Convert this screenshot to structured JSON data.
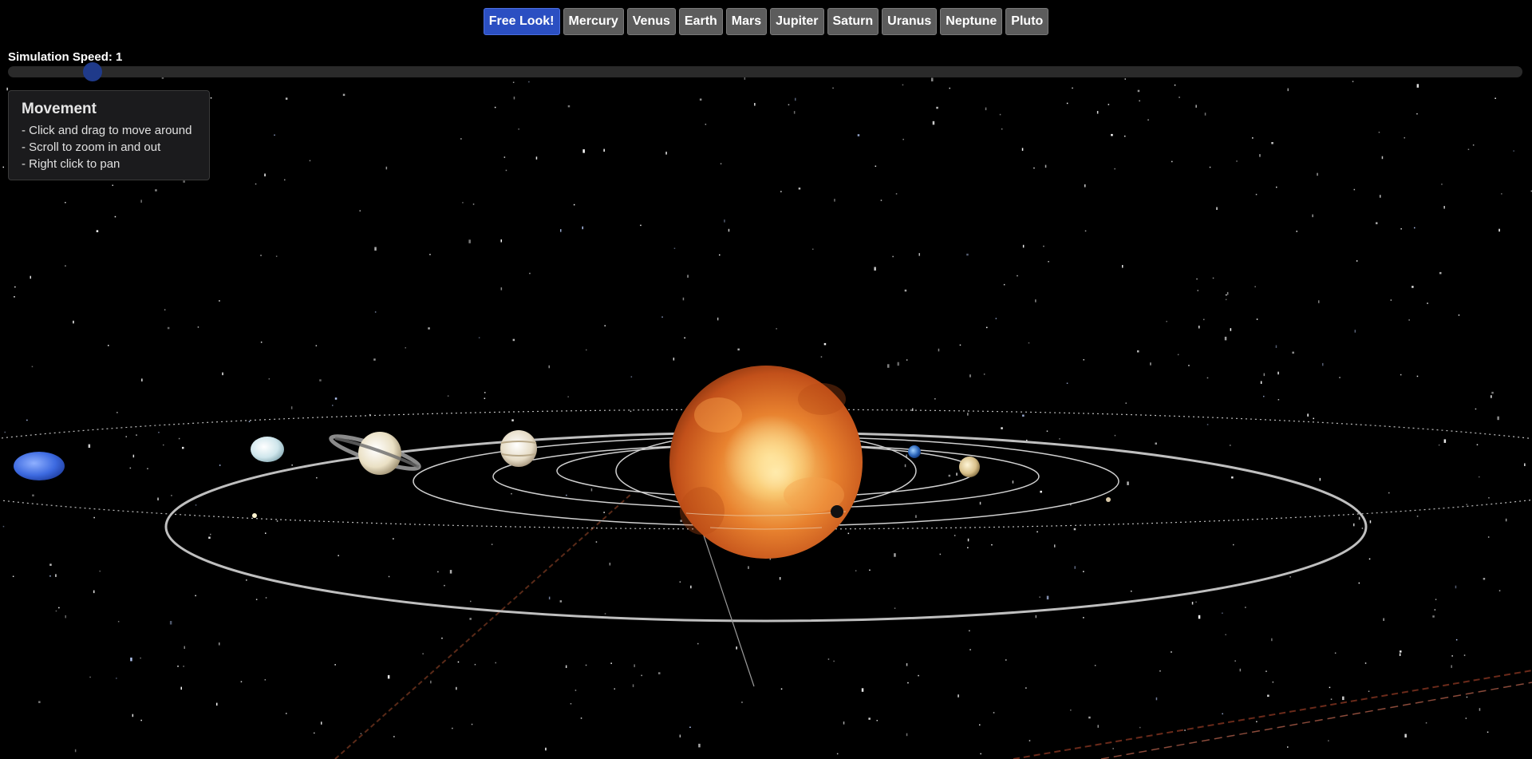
{
  "nav": {
    "buttons": [
      {
        "label": "Free Look!",
        "active": true
      },
      {
        "label": "Mercury",
        "active": false
      },
      {
        "label": "Venus",
        "active": false
      },
      {
        "label": "Earth",
        "active": false
      },
      {
        "label": "Mars",
        "active": false
      },
      {
        "label": "Jupiter",
        "active": false
      },
      {
        "label": "Saturn",
        "active": false
      },
      {
        "label": "Uranus",
        "active": false
      },
      {
        "label": "Neptune",
        "active": false
      },
      {
        "label": "Pluto",
        "active": false
      }
    ]
  },
  "speed": {
    "label": "Simulation Speed: 1",
    "value": 1
  },
  "help": {
    "title": "Movement",
    "lines": [
      "- Click and drag to move around",
      "- Scroll to zoom in and out",
      "- Right click to pan"
    ]
  },
  "colors": {
    "active_button": "#2b4fc2",
    "button": "#5c5c5c",
    "sun": "#e0742a",
    "background": "#000000"
  }
}
